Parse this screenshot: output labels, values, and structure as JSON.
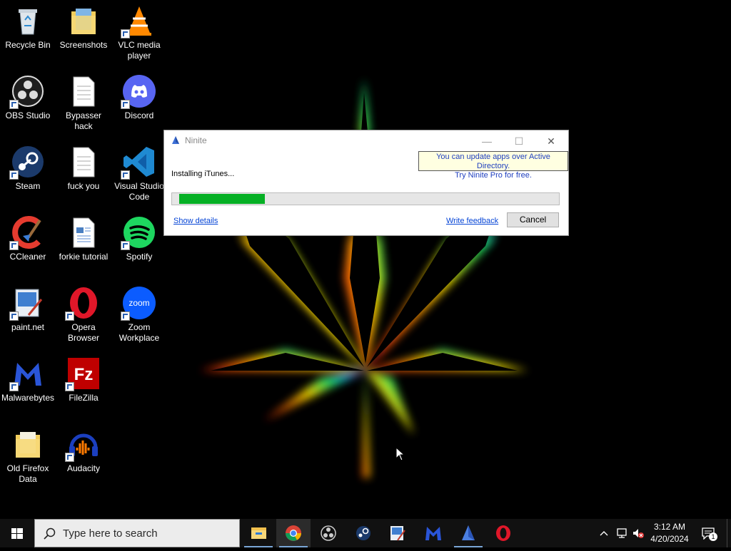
{
  "desktop": {
    "icons": [
      {
        "label": "Recycle Bin",
        "icon": "recycle-bin-icon"
      },
      {
        "label": "Screenshots",
        "icon": "folder-icon"
      },
      {
        "label": "VLC media player",
        "icon": "vlc-icon"
      },
      {
        "label": "OBS Studio",
        "icon": "obs-icon"
      },
      {
        "label": "Bypasser hack",
        "icon": "text-file-icon"
      },
      {
        "label": "Discord",
        "icon": "discord-icon"
      },
      {
        "label": "Steam",
        "icon": "steam-icon"
      },
      {
        "label": "fuck you",
        "icon": "text-file-icon"
      },
      {
        "label": "Visual Studio Code",
        "icon": "vscode-icon"
      },
      {
        "label": "CCleaner",
        "icon": "ccleaner-icon"
      },
      {
        "label": "forkie tutorial",
        "icon": "document-icon"
      },
      {
        "label": "Spotify",
        "icon": "spotify-icon"
      },
      {
        "label": "paint.net",
        "icon": "paintnet-icon"
      },
      {
        "label": "Opera Browser",
        "icon": "opera-icon"
      },
      {
        "label": "Zoom Workplace",
        "icon": "zoom-icon"
      },
      {
        "label": "Malwarebytes",
        "icon": "malwarebytes-icon"
      },
      {
        "label": "FileZilla",
        "icon": "filezilla-icon"
      },
      {
        "label": "Old Firefox Data",
        "icon": "folder-icon"
      },
      {
        "label": "Audacity",
        "icon": "audacity-icon"
      }
    ],
    "zoom_logo_text": "zoom",
    "filezilla_logo_text": "Fz"
  },
  "dialog": {
    "title": "Ninite",
    "ad_line1": "You can update apps over Active Directory.",
    "ad_line2": "Try Ninite Pro for free.",
    "status": "Installing iTunes...",
    "progress_fraction": 0.23,
    "show_details": "Show details",
    "write_feedback": "Write feedback",
    "cancel": "Cancel",
    "minimize_glyph": "—",
    "maximize_glyph": "☐",
    "close_glyph": "✕"
  },
  "taskbar": {
    "search_placeholder": "Type here to search",
    "apps": [
      "file-explorer-icon",
      "chrome-icon",
      "obs-icon",
      "steam-icon",
      "paintnet-icon",
      "malwarebytes-icon",
      "ninite-icon",
      "opera-icon"
    ],
    "time": "3:12 AM",
    "date": "4/20/2024",
    "notification_count": "1"
  },
  "colors": {
    "progress_green": "#06b025",
    "taskbar": "#111111",
    "link_blue": "#0645d6"
  }
}
